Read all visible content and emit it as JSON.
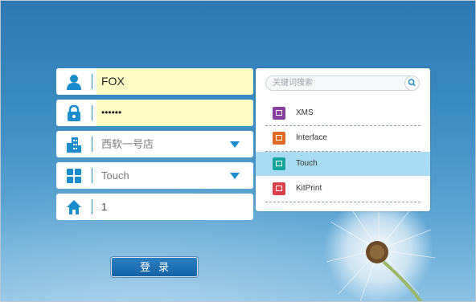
{
  "login": {
    "username": "FOX",
    "password": "••••••",
    "store": "西软一号店",
    "mode": "Touch",
    "station": "1",
    "submit_label": "登录"
  },
  "app_panel": {
    "search_placeholder": "关键词搜索",
    "selected": "Touch",
    "items": [
      {
        "label": "XMS",
        "color": "#8a3fa0"
      },
      {
        "label": "Interface",
        "color": "#e06a21"
      },
      {
        "label": "Touch",
        "color": "#14a59a"
      },
      {
        "label": "KitPrint",
        "color": "#d9424b"
      }
    ]
  },
  "colors": {
    "accent": "#1a8ccb",
    "autofill": "#fcfcc4",
    "selected_row": "#a9dcf3"
  }
}
